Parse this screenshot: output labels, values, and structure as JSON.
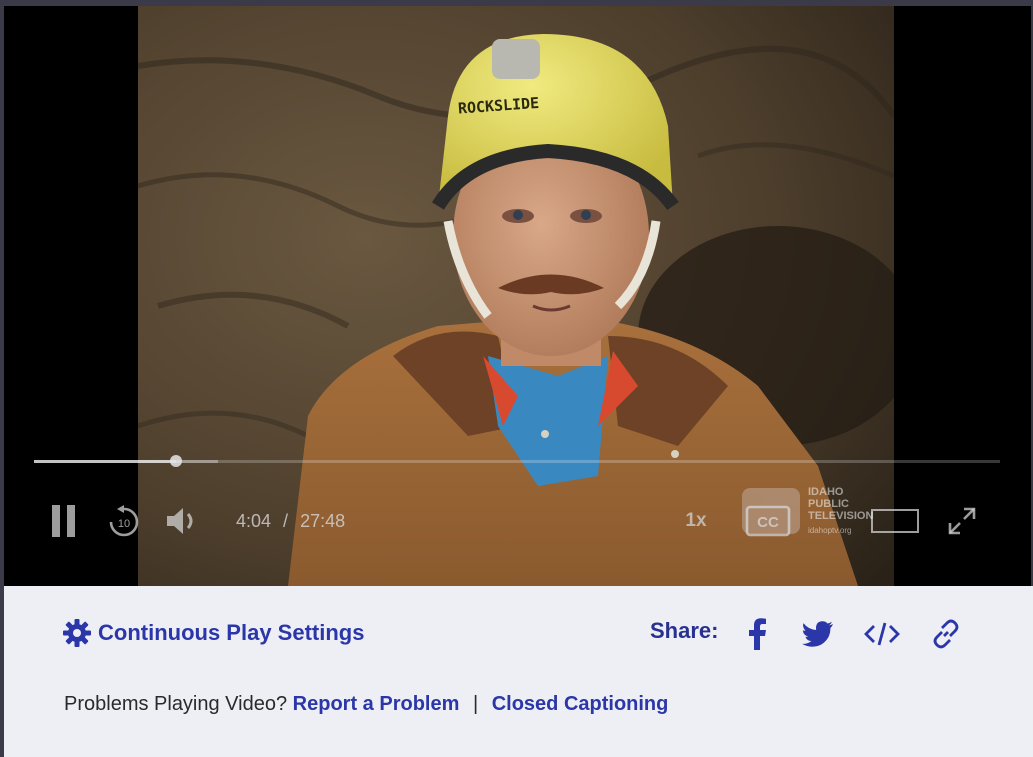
{
  "player": {
    "progress_fraction": 0.147,
    "buffered_fraction": 0.19,
    "current_time": "4:04",
    "separator": "/",
    "duration": "27:48",
    "speed_label": "1x",
    "cc_label": "CC",
    "icons": {
      "pause": "pause-icon",
      "rewind": "rewind-10-icon",
      "rewind_label": "10",
      "volume": "volume-icon",
      "captions": "closed-captions-icon",
      "fullscreen": "fullscreen-icon"
    },
    "watermark": {
      "line1": "IDAHO",
      "line2": "PUBLIC",
      "line3": "TELEVISION",
      "url": "idahoptv.org"
    },
    "helmet_text": "ROCKSLIDE"
  },
  "panel": {
    "continuous_play_label": "Continuous Play Settings",
    "share_label": "Share:",
    "share_icons": [
      "facebook-icon",
      "twitter-icon",
      "embed-code-icon",
      "link-icon"
    ],
    "problems_text": "Problems Playing Video?",
    "report_link": "Report a Problem",
    "separator": "|",
    "cc_link": "Closed Captioning",
    "accent_color": "#2b37a8"
  }
}
